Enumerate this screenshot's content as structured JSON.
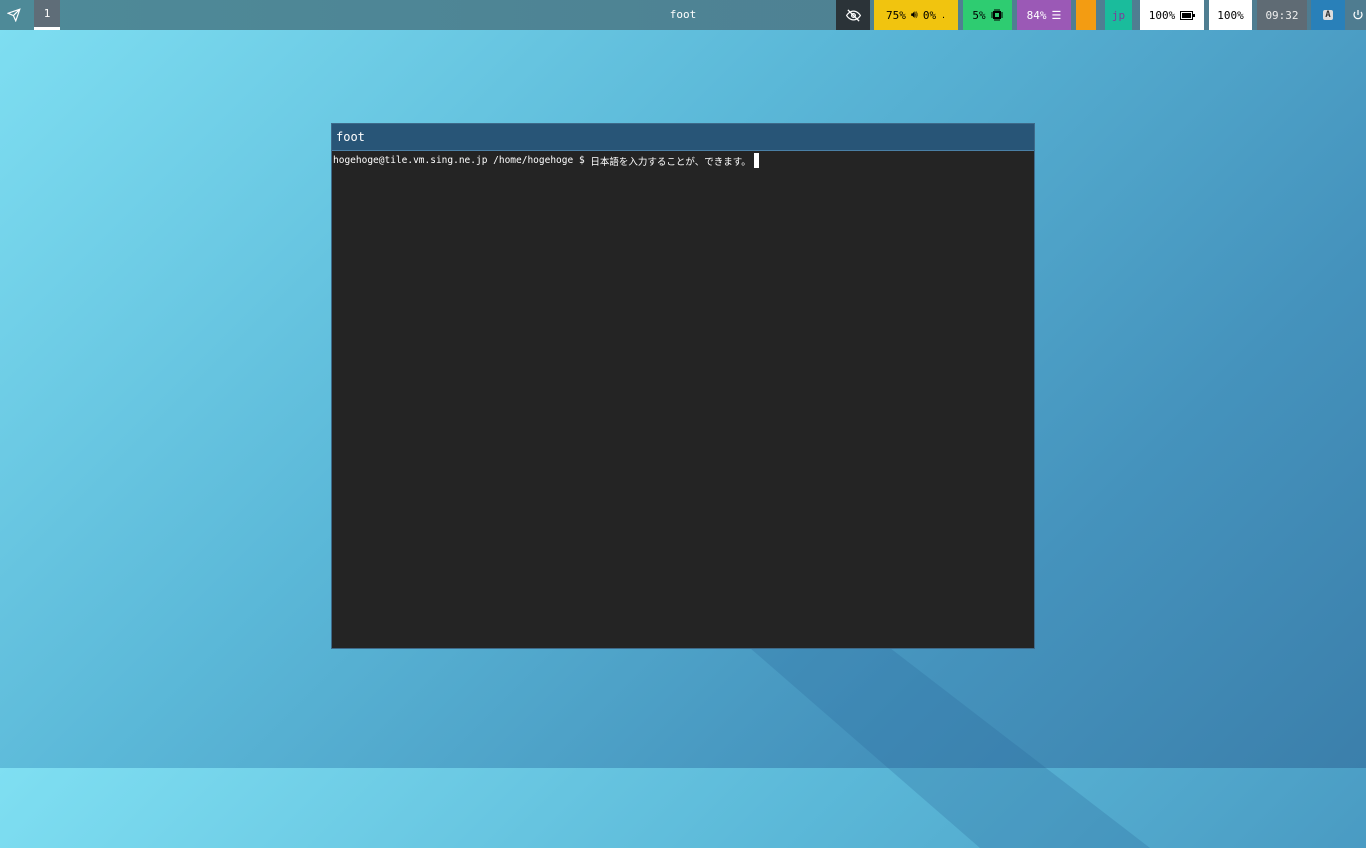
{
  "topbar": {
    "workspace": "1",
    "window_title": "foot",
    "volume": "75%",
    "mic": "0%",
    "mic_suffix": ".",
    "cpu": "5%",
    "memory": "84%",
    "keyboard_layout": "jp",
    "battery": "100%",
    "brightness": "100%",
    "clock": "09:32",
    "colors": {
      "yellow": "#f1c40f",
      "green": "#2ecc71",
      "purple": "#9b59b6",
      "orange": "#f39c12",
      "teal": "#1abc9c",
      "blue": "#2980b9"
    }
  },
  "window": {
    "title": "foot",
    "prompt": "hogehoge@tile.vm.sing.ne.jp /home/hogehoge $ ",
    "input": "日本語を入力することが、できます。"
  }
}
